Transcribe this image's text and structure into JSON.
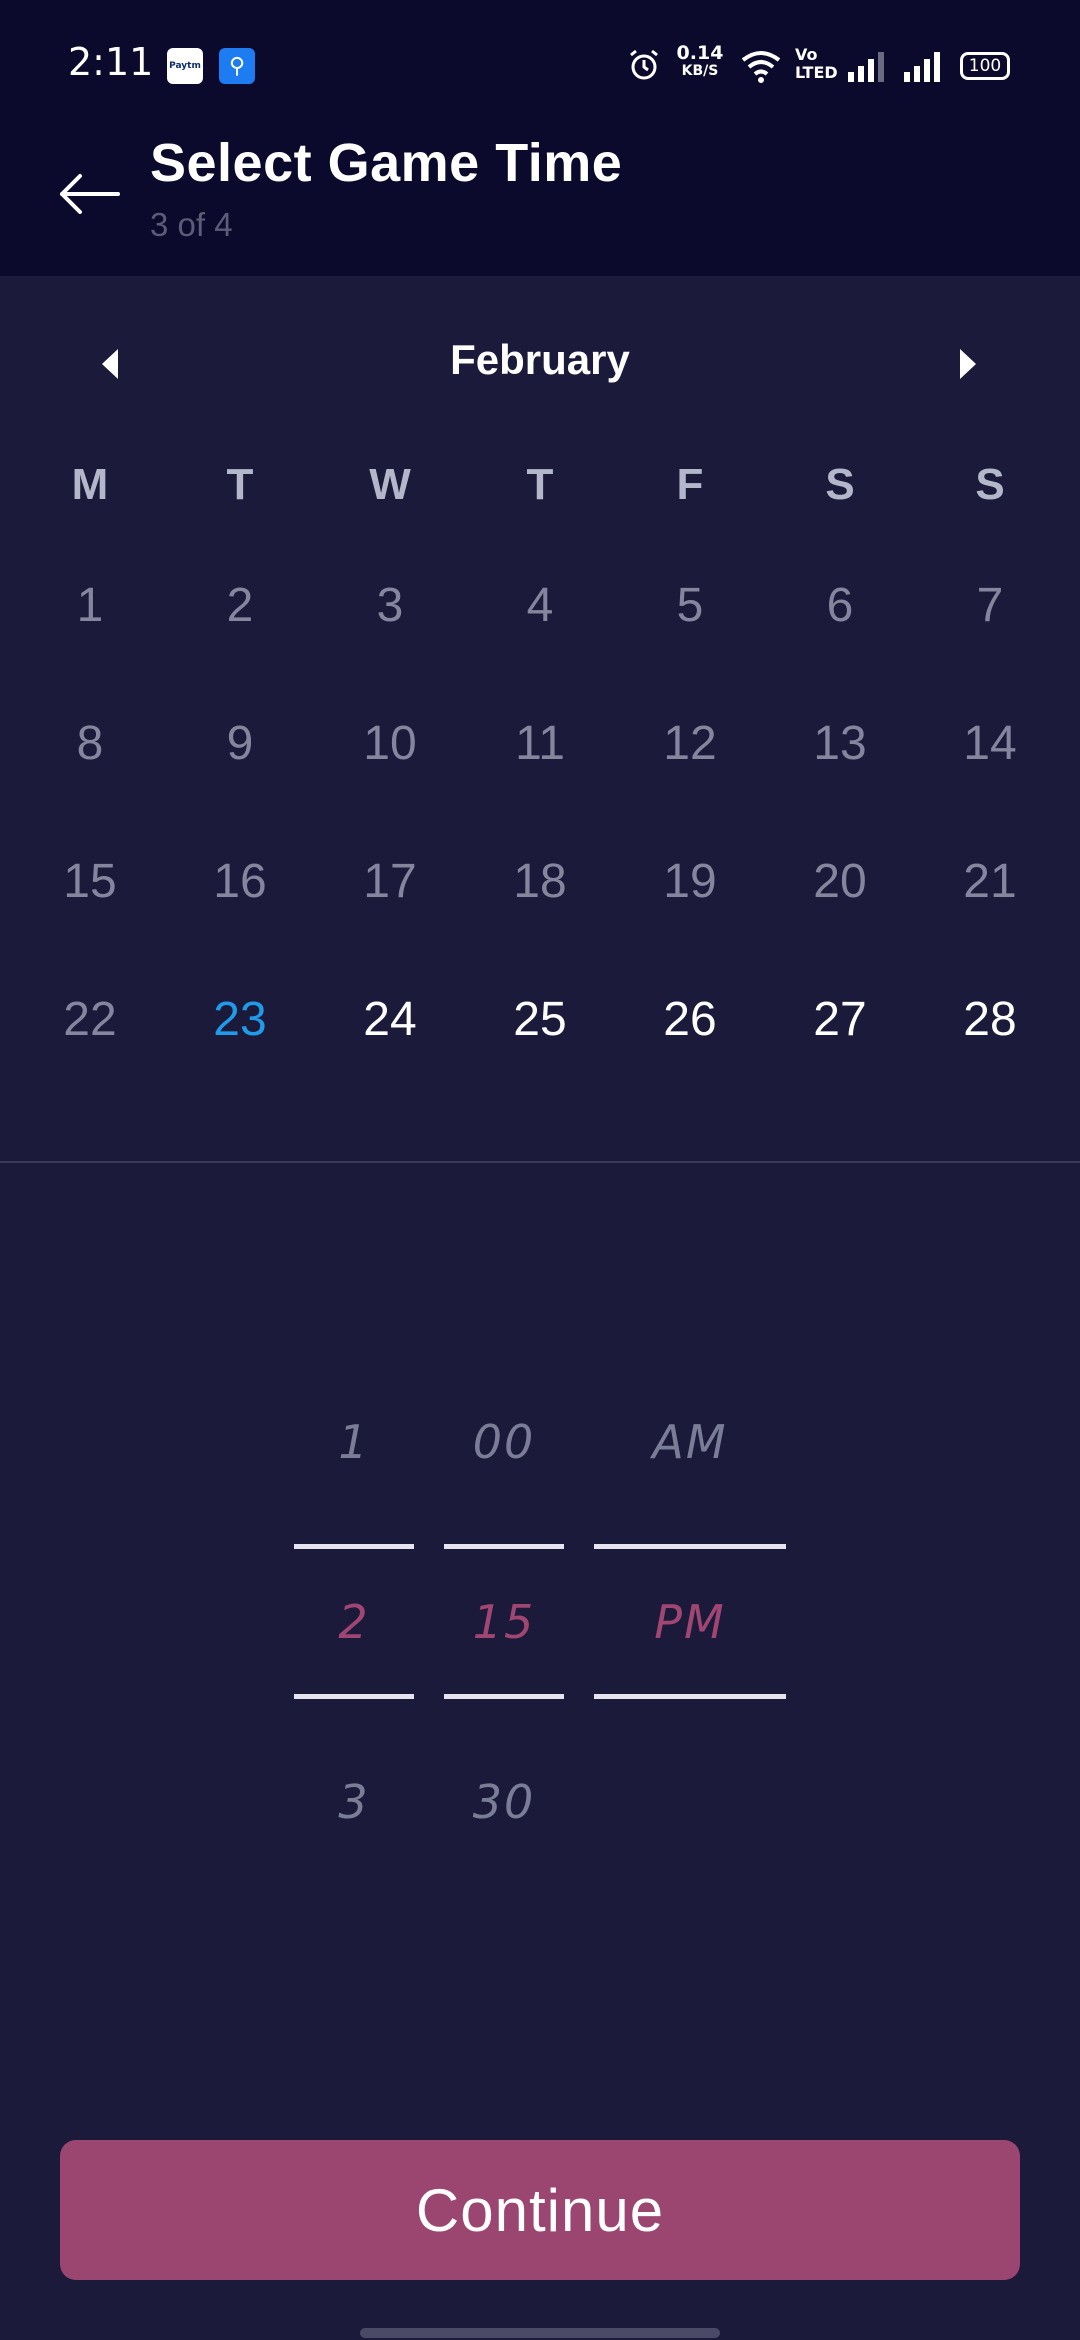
{
  "status_bar": {
    "time": "2:11",
    "paytm_label": "Paytm",
    "net_speed_value": "0.14",
    "net_speed_unit": "KB/S",
    "volte_label_1": "Vo",
    "volte_label_2": "LTED",
    "battery": "100",
    "icons": [
      "paytm-icon",
      "usb-icon",
      "alarm-icon",
      "wifi-icon",
      "signal-icon",
      "signal-icon",
      "battery-icon"
    ]
  },
  "header": {
    "title": "Select Game Time",
    "step": "3 of 4",
    "back_icon": "arrow-left-icon"
  },
  "calendar": {
    "month": "February",
    "weekdays": [
      "M",
      "T",
      "W",
      "T",
      "F",
      "S",
      "S"
    ],
    "weeks": [
      [
        "1",
        "2",
        "3",
        "4",
        "5",
        "6",
        "7"
      ],
      [
        "8",
        "9",
        "10",
        "11",
        "12",
        "13",
        "14"
      ],
      [
        "15",
        "16",
        "17",
        "18",
        "19",
        "20",
        "21"
      ],
      [
        "22",
        "23",
        "24",
        "25",
        "26",
        "27",
        "28"
      ]
    ],
    "today": "23",
    "colors": {
      "past": "#85869e",
      "today": "#1f9bea",
      "upcoming": "#ffffff"
    }
  },
  "time_picker": {
    "hour": {
      "prev": "1",
      "selected": "2",
      "next": "3"
    },
    "minute": {
      "prev": "00",
      "selected": "15",
      "next": "30"
    },
    "period": {
      "prev": "AM",
      "selected": "PM"
    },
    "selected_color": "#a04672"
  },
  "continue_label": "Continue",
  "accent_color": "#9b4571"
}
